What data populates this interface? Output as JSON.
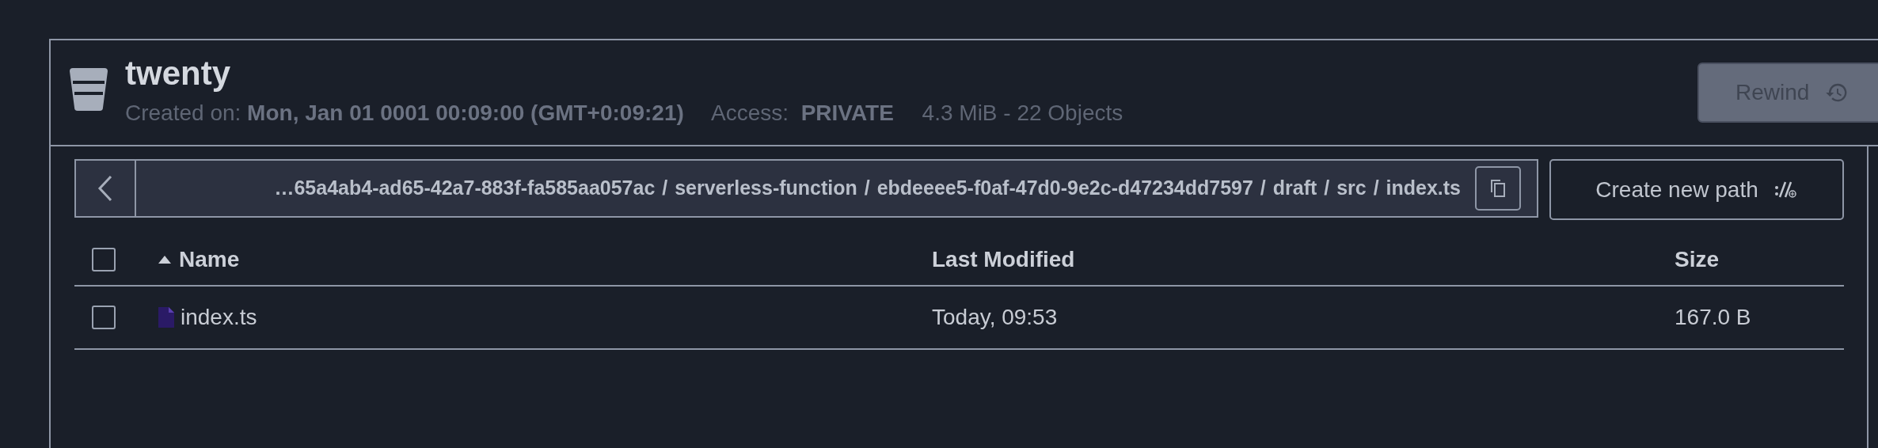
{
  "bucket": {
    "name": "twenty",
    "created_label": "Created on:",
    "created_value": "Mon, Jan 01 0001 00:09:00 (GMT+0:09:21)",
    "access_label": "Access:",
    "access_value": "PRIVATE",
    "usage": "4.3 MiB - 22 Objects"
  },
  "rewind_button": {
    "label": "Rewind",
    "disabled": true
  },
  "breadcrumb": "…65a4ab4-ad65-42a7-883f-fa585aa057ac / serverless-function / ebdeeee5-f0af-47d0-9e2c-d47234dd7597 / draft / src / index.ts",
  "create_path_button": {
    "label": "Create new path"
  },
  "table": {
    "columns": [
      {
        "label": "Name",
        "sorted": true
      },
      {
        "label": "Last Modified",
        "sorted": false
      },
      {
        "label": "Size",
        "sorted": false
      }
    ],
    "select_all_checked": false,
    "rows": [
      {
        "name": "index.ts",
        "modified": "Today, 09:53",
        "size": "167.0 B",
        "checked": false
      }
    ]
  }
}
